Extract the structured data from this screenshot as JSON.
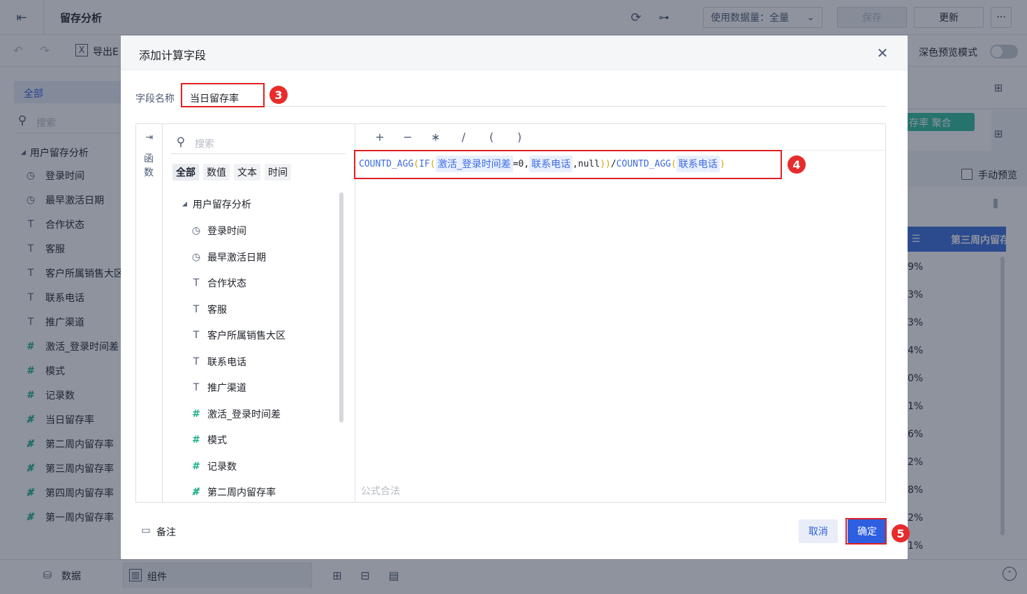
{
  "app": {
    "title": "留存分析",
    "data_amount_label": "使用数据量：全量",
    "save_label": "保存",
    "update_label": "更新",
    "more_label": "···",
    "export_label": "导出E",
    "dark_preview_label": "深色预览模式",
    "manual_preview_label": "手动预览",
    "chip_label": "存率 聚合",
    "column_header": "第三周内留存",
    "right_values": [
      "9%",
      "3%",
      "3%",
      "4%",
      "0%",
      "1%",
      "6%",
      "2%",
      "8%",
      "2%",
      "1%"
    ]
  },
  "left_panel": {
    "tab_all": "全部",
    "search_placeholder": "搜索",
    "group": "用户留存分析",
    "fields": [
      {
        "label": "登录时间",
        "icon": "clock-icon"
      },
      {
        "label": "最早激活日期",
        "icon": "clock-icon"
      },
      {
        "label": "合作状态",
        "icon": "text-type-icon"
      },
      {
        "label": "客服",
        "icon": "text-type-icon"
      },
      {
        "label": "客户所属销售大区",
        "icon": "text-type-icon"
      },
      {
        "label": "联系电话",
        "icon": "text-type-icon"
      },
      {
        "label": "推广渠道",
        "icon": "text-type-icon"
      },
      {
        "label": "激活_登录时间差",
        "icon": "number-type-icon"
      },
      {
        "label": "模式",
        "icon": "number-type-icon"
      },
      {
        "label": "记录数",
        "icon": "number-type-icon"
      },
      {
        "label": "当日留存率",
        "icon": "calc-number-icon"
      },
      {
        "label": "第二周内留存率",
        "icon": "calc-number-icon"
      },
      {
        "label": "第三周内留存率",
        "icon": "calc-number-icon"
      },
      {
        "label": "第四周内留存率",
        "icon": "calc-number-icon"
      },
      {
        "label": "第一周内留存率",
        "icon": "calc-number-icon"
      }
    ]
  },
  "bottom_bar": {
    "data_tab": "数据",
    "component_tab": "组件"
  },
  "modal": {
    "title": "添加计算字段",
    "field_name_label": "字段名称",
    "field_name_value": "当日留存率",
    "functions_label": "函数",
    "search_placeholder": "搜索",
    "filter_tabs": [
      "全部",
      "数值",
      "文本",
      "时间"
    ],
    "tree_group": "用户留存分析",
    "tree_items": [
      {
        "label": "登录时间",
        "icon": "clock-icon"
      },
      {
        "label": "最早激活日期",
        "icon": "clock-icon"
      },
      {
        "label": "合作状态",
        "icon": "text-type-icon"
      },
      {
        "label": "客服",
        "icon": "text-type-icon"
      },
      {
        "label": "客户所属销售大区",
        "icon": "text-type-icon"
      },
      {
        "label": "联系电话",
        "icon": "text-type-icon"
      },
      {
        "label": "推广渠道",
        "icon": "text-type-icon"
      },
      {
        "label": "激活_登录时间差",
        "icon": "number-type-icon"
      },
      {
        "label": "模式",
        "icon": "number-type-icon"
      },
      {
        "label": "记录数",
        "icon": "number-type-icon"
      },
      {
        "label": "第二周内留存率",
        "icon": "calc-number-icon"
      }
    ],
    "operators": [
      "+",
      "−",
      "∗",
      "/",
      "(",
      ")"
    ],
    "formula": {
      "fn1": "COUNTD_AGG",
      "fn2": "IF",
      "field1": "激活_登录时间差",
      "cond": "=0,",
      "field2": "联系电话",
      "tail": ",null",
      "div": "/",
      "fn3": "COUNTD_AGG",
      "field3": "联系电话"
    },
    "status": "公式合法",
    "note_label": "备注",
    "cancel_label": "取消",
    "confirm_label": "确定"
  },
  "annotations": {
    "step3": "3",
    "step4": "4",
    "step5": "5"
  },
  "colors": {
    "accent": "#2e5fe0",
    "highlight": "#e02020",
    "number_icon": "#1aae8a"
  }
}
